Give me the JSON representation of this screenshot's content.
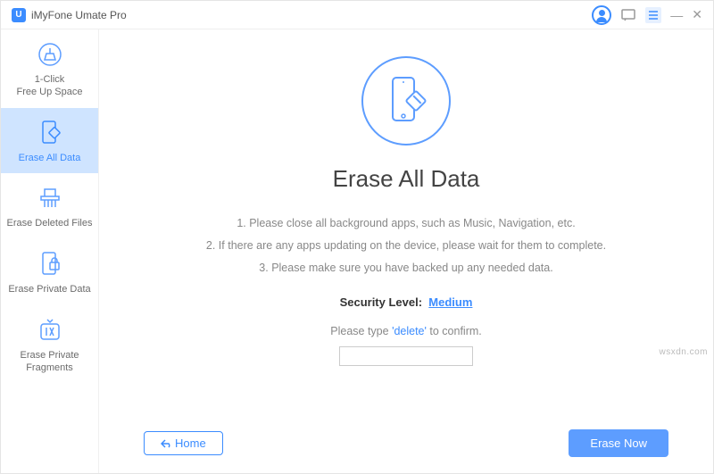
{
  "app": {
    "title": "iMyFone Umate Pro",
    "logo_letter": "U"
  },
  "sidebar": {
    "items": [
      {
        "label": "1-Click\nFree Up Space"
      },
      {
        "label": "Erase All Data"
      },
      {
        "label": "Erase Deleted Files"
      },
      {
        "label": "Erase Private Data"
      },
      {
        "label": "Erase Private\nFragments"
      }
    ]
  },
  "main": {
    "title": "Erase All Data",
    "instructions": [
      "1. Please close all background apps, such as Music, Navigation, etc.",
      "2. If there are any apps updating on the device, please wait for them to complete.",
      "3. Please make sure you have backed up any needed data."
    ],
    "security_label": "Security Level:",
    "security_value": "Medium",
    "confirm_prefix": "Please type",
    "confirm_keyword": "'delete'",
    "confirm_suffix": "to confirm.",
    "confirm_input_value": ""
  },
  "footer": {
    "home_label": "Home",
    "erase_label": "Erase Now"
  },
  "watermark": "wsxdn.com"
}
